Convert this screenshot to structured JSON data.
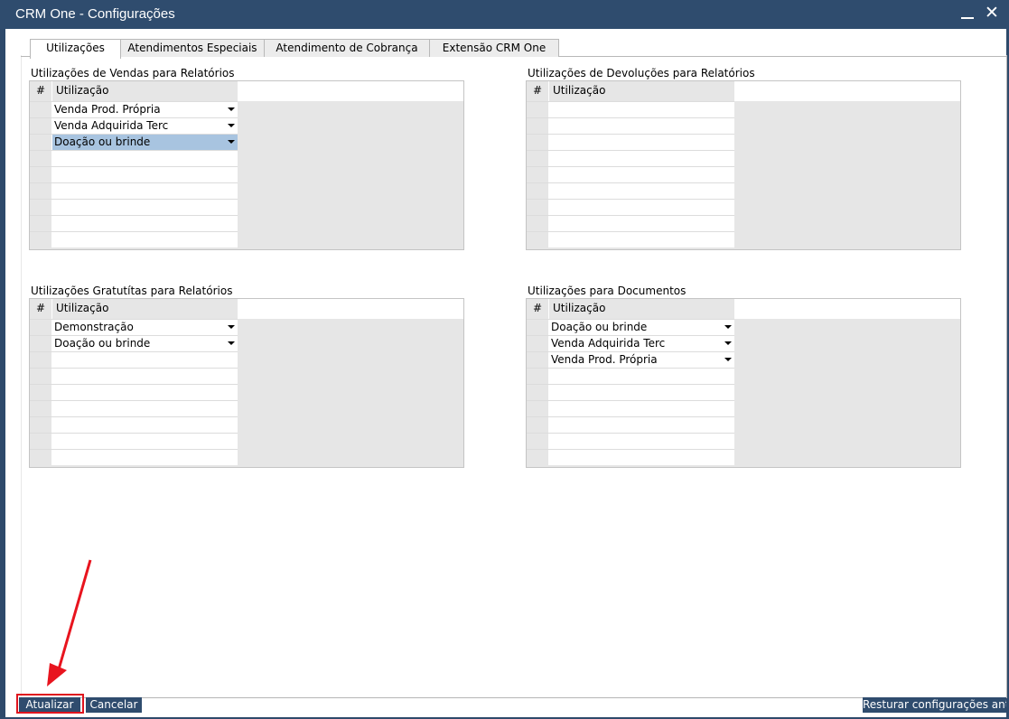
{
  "window": {
    "title": "CRM One - Configurações"
  },
  "tabs": [
    {
      "label": "Utilizações"
    },
    {
      "label": "Atendimentos Especiais"
    },
    {
      "label": "Atendimento de Cobrança"
    },
    {
      "label": "Extensão CRM One"
    }
  ],
  "groups": [
    {
      "title": "Utilizações de Vendas para Relatórios",
      "col_num": "#",
      "col_name": "Utilização",
      "rows": [
        "Venda Prod. Própria",
        "Venda Adquirida Terc",
        "Doação ou brinde",
        "",
        "",
        "",
        "",
        "",
        ""
      ],
      "selected_row": 2
    },
    {
      "title": "Utilizações de Devoluções para Relatórios",
      "col_num": "#",
      "col_name": "Utilização",
      "rows": [
        "",
        "",
        "",
        "",
        "",
        "",
        "",
        "",
        ""
      ]
    },
    {
      "title": "Utilizações Gratutítas para Relatórios",
      "col_num": "#",
      "col_name": "Utilização",
      "rows": [
        "Demonstração",
        "Doação ou brinde",
        "",
        "",
        "",
        "",
        "",
        "",
        ""
      ]
    },
    {
      "title": "Utilizações para Documentos",
      "col_num": "#",
      "col_name": "Utilização",
      "rows": [
        "Doação ou brinde",
        "Venda Adquirida Terc",
        "Venda Prod. Própria",
        "",
        "",
        "",
        "",
        "",
        ""
      ]
    }
  ],
  "buttons": {
    "update": "Atualizar",
    "cancel": "Cancelar",
    "restore": "Resturar configurações ant..."
  },
  "colors": {
    "titlebar": "#2f4c6e",
    "selection": "#a8c4e0",
    "annotation": "#e0141e"
  },
  "icons": {
    "minimize": "minimize-icon",
    "close": "close-icon",
    "dropdown": "chevron-down-icon"
  }
}
